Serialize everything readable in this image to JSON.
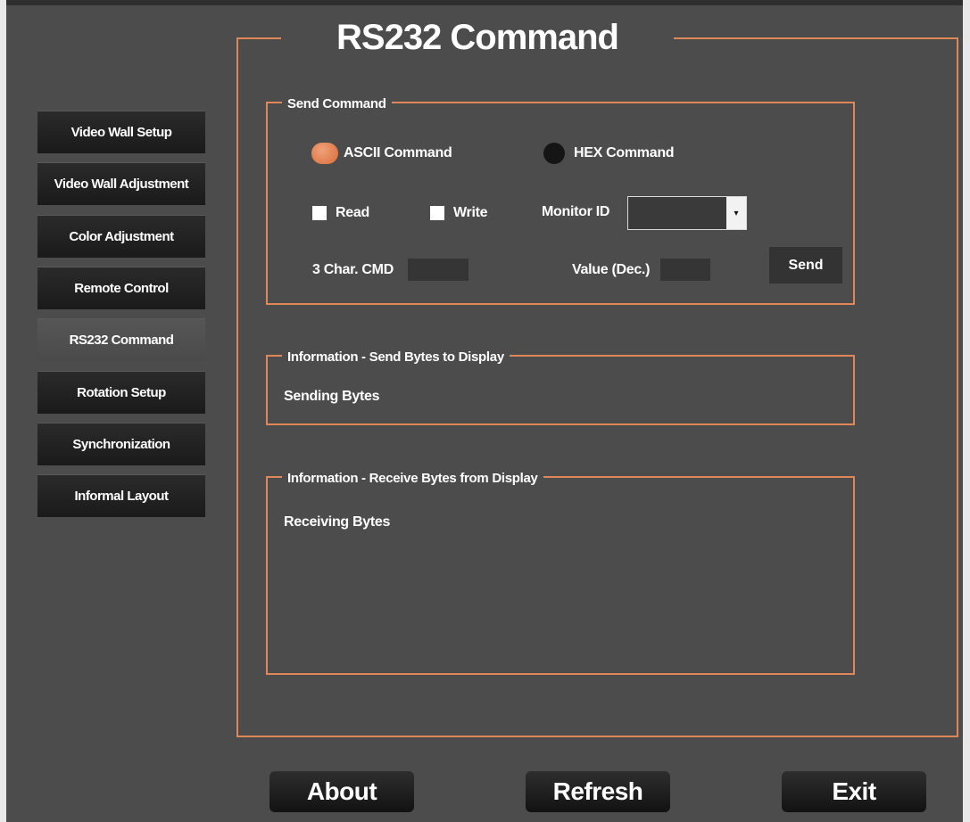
{
  "title": "RS232 Command",
  "sidebar": {
    "items": [
      {
        "label": "Video Wall Setup"
      },
      {
        "label": "Video Wall Adjustment"
      },
      {
        "label": "Color Adjustment"
      },
      {
        "label": "Remote Control"
      },
      {
        "label": "RS232 Command",
        "active": true
      },
      {
        "label": "Rotation Setup"
      },
      {
        "label": "Synchronization"
      },
      {
        "label": "Informal Layout"
      }
    ]
  },
  "send_command": {
    "legend": "Send Command",
    "ascii_label": "ASCII Command",
    "hex_label": "HEX Command",
    "selected_mode": "ASCII Command",
    "read_label": "Read",
    "write_label": "Write",
    "monitor_id_label": "Monitor ID",
    "monitor_id_value": "",
    "cmd_label": "3 Char. CMD",
    "cmd_value": "",
    "value_label": "Value (Dec.)",
    "value_value": "",
    "send_label": "Send"
  },
  "info_send": {
    "legend": "Information - Send Bytes to Display",
    "text": "Sending Bytes"
  },
  "info_receive": {
    "legend": "Information - Receive Bytes from Display",
    "text": "Receiving Bytes"
  },
  "footer": {
    "about_label": "About",
    "refresh_label": "Refresh",
    "exit_label": "Exit"
  },
  "colors": {
    "accent": "#e0875a",
    "background": "#4c4c4c",
    "button": "#1e1e1e"
  }
}
